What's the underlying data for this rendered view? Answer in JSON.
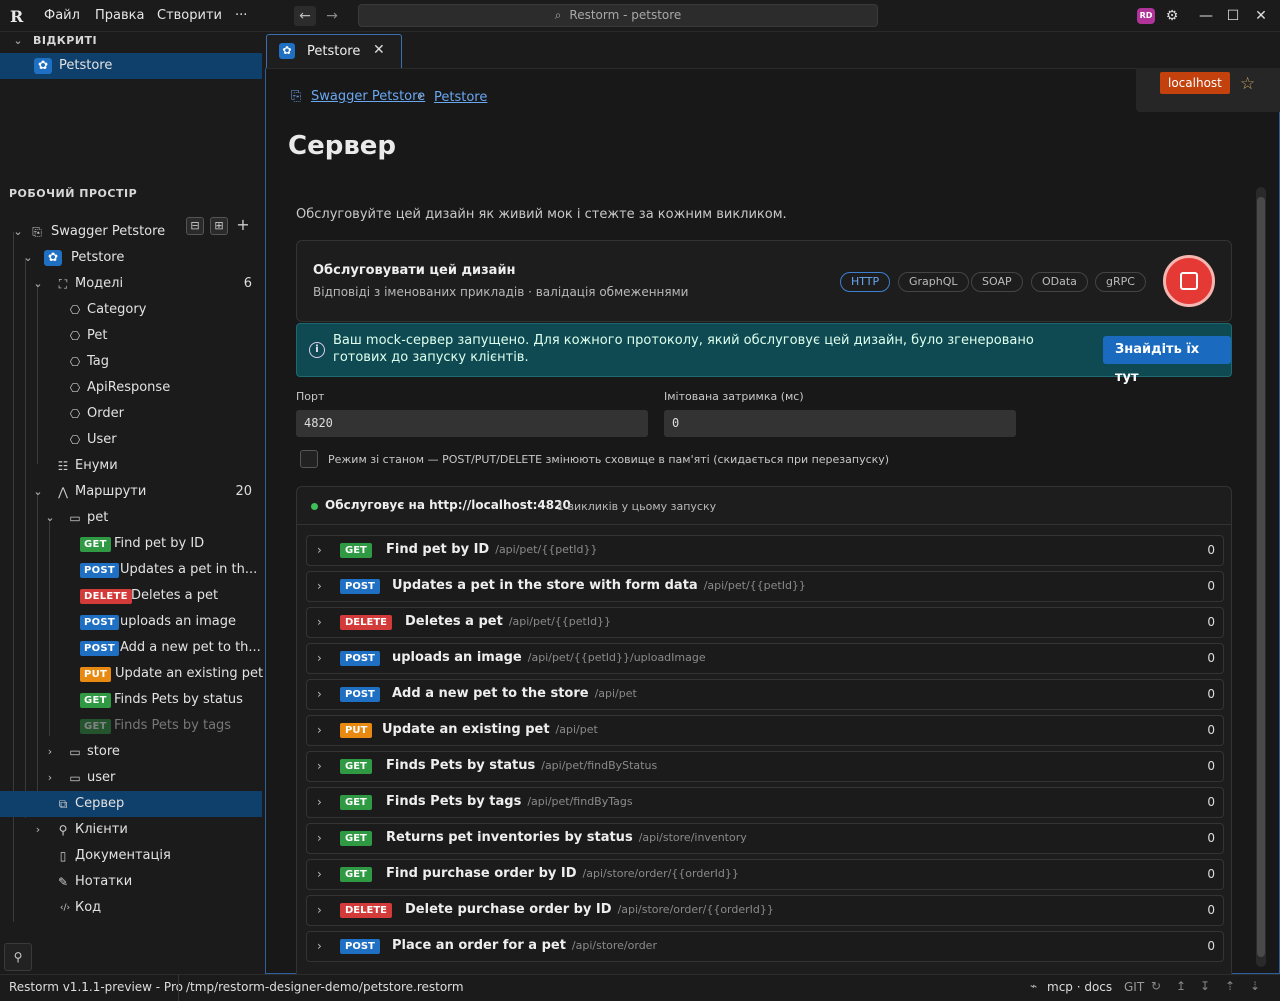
{
  "app": {
    "menu": [
      "Файл",
      "Правка",
      "Створити",
      "···"
    ],
    "search": "Restorm - petstore",
    "avatar": "RD"
  },
  "sidebar": {
    "open_header": "ВІДКРИТІ",
    "open_item": "Petstore",
    "workspace_header": "РОБОЧИЙ ПРОСТІР",
    "tree": [
      {
        "label": "Swagger Petstore"
      },
      {
        "label": "Petstore"
      },
      {
        "label": "Моделі",
        "count": "6"
      },
      {
        "label": "Category"
      },
      {
        "label": "Pet"
      },
      {
        "label": "Tag"
      },
      {
        "label": "ApiResponse"
      },
      {
        "label": "Order"
      },
      {
        "label": "User"
      },
      {
        "label": "Енуми"
      },
      {
        "label": "Маршрути",
        "count": "20"
      },
      {
        "label": "pet"
      },
      {
        "method": "GET",
        "label": "Find pet by ID"
      },
      {
        "method": "POST",
        "label": "Updates a pet in th..."
      },
      {
        "method": "DELETE",
        "label": "Deletes a pet"
      },
      {
        "method": "POST",
        "label": "uploads an image"
      },
      {
        "method": "POST",
        "label": "Add a new pet to th..."
      },
      {
        "method": "PUT",
        "label": "Update an existing pet"
      },
      {
        "method": "GET",
        "label": "Finds Pets by status"
      },
      {
        "method": "GET",
        "label": "Finds Pets by tags"
      },
      {
        "label": "store"
      },
      {
        "label": "user"
      },
      {
        "label": "Сервер"
      },
      {
        "label": "Клієнти"
      },
      {
        "label": "Документація"
      },
      {
        "label": "Нотатки"
      },
      {
        "label": "Код"
      }
    ]
  },
  "status": {
    "version": "Restorm v1.1.1-preview - Pro",
    "path": "/tmp/restorm-designer-demo/petstore.restorm",
    "mcp": "mcp · docs",
    "git": "GIT"
  },
  "tab": {
    "label": "Petstore"
  },
  "main": {
    "breadcrumb": [
      "Swagger Petstore",
      "Petstore"
    ],
    "env": "localhost",
    "title": "Сервер",
    "description": "Обслуговуйте цей дизайн як живий мок і стежте за кожним викликом.",
    "serve": {
      "title": "Обслуговувати цей дизайн",
      "subtitle": "Відповіді з іменованих прикладів · валідація обмеженнями",
      "protocols": [
        "HTTP",
        "GraphQL",
        "SOAP",
        "OData",
        "gRPC"
      ],
      "active_protocol": "HTTP"
    },
    "info": {
      "text": "Ваш mock-сервер запущено. Для кожного протоколу, який обслуговує цей дизайн, було згенеровано готових до запуску клієнтів.",
      "button": "Знайдіть їх тут"
    },
    "port_label": "Порт",
    "port_value": "4820",
    "latency_label": "Імітована затримка (мс)",
    "latency_value": "0",
    "stateful_label": "Режим зі станом — POST/PUT/DELETE змінюють сховище в пам'яті (скидається при перезапуску)",
    "serving_label": "Обслуговує на http://localhost:4820",
    "calls_label": "1 викликів у цьому запуску",
    "routes": [
      {
        "method": "GET",
        "name": "Find pet by ID",
        "path": "/api/pet/{{petId}}",
        "count": "0"
      },
      {
        "method": "POST",
        "name": "Updates a pet in the store with form data",
        "path": "/api/pet/{{petId}}",
        "count": "0"
      },
      {
        "method": "DELETE",
        "name": "Deletes a pet",
        "path": "/api/pet/{{petId}}",
        "count": "0"
      },
      {
        "method": "POST",
        "name": "uploads an image",
        "path": "/api/pet/{{petId}}/uploadImage",
        "count": "0"
      },
      {
        "method": "POST",
        "name": "Add a new pet to the store",
        "path": "/api/pet",
        "count": "0"
      },
      {
        "method": "PUT",
        "name": "Update an existing pet",
        "path": "/api/pet",
        "count": "0"
      },
      {
        "method": "GET",
        "name": "Finds Pets by status",
        "path": "/api/pet/findByStatus",
        "count": "0"
      },
      {
        "method": "GET",
        "name": "Finds Pets by tags",
        "path": "/api/pet/findByTags",
        "count": "0"
      },
      {
        "method": "GET",
        "name": "Returns pet inventories by status",
        "path": "/api/store/inventory",
        "count": "0"
      },
      {
        "method": "GET",
        "name": "Find purchase order by ID",
        "path": "/api/store/order/{{orderId}}",
        "count": "0"
      },
      {
        "method": "DELETE",
        "name": "Delete purchase order by ID",
        "path": "/api/store/order/{{orderId}}",
        "count": "0"
      },
      {
        "method": "POST",
        "name": "Place an order for a pet",
        "path": "/api/store/order",
        "count": "0"
      }
    ]
  }
}
